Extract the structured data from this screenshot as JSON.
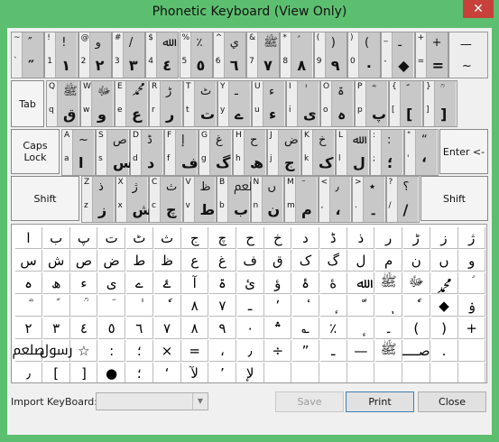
{
  "window": {
    "title": "Phonetic Keyboard (View Only)",
    "close_glyph": "✕"
  },
  "row1": {
    "keys": [
      {
        "top": "~",
        "bot": "`",
        "u1": "″",
        "u2": "″",
        "u3": "",
        "u4": ""
      },
      {
        "top": "!",
        "bot": "1",
        "u1": "!",
        "u2": "١",
        "u3": "",
        "u4": ""
      },
      {
        "top": "@",
        "bot": "2",
        "u1": "و",
        "u2": "٢",
        "u3": "",
        "u4": ""
      },
      {
        "top": "#",
        "bot": "3",
        "u1": "/",
        "u2": "٣",
        "u3": "",
        "u4": ""
      },
      {
        "top": "$",
        "bot": "4",
        "u1": "ﷲ",
        "u2": "٤",
        "u3": "",
        "u4": ""
      },
      {
        "top": "%",
        "bot": "5",
        "u1": "٪",
        "u2": "٥",
        "u3": "",
        "u4": ""
      },
      {
        "top": "^",
        "bot": "6",
        "u1": "ي",
        "u2": "٦",
        "u3": "",
        "u4": ""
      },
      {
        "top": "&",
        "bot": "7",
        "u1": "ﷺ",
        "u2": "٧",
        "u3": "",
        "u4": ""
      },
      {
        "top": "*",
        "bot": "8",
        "u1": "ؑ",
        "u2": "٨",
        "u3": "",
        "u4": ""
      },
      {
        "top": "(",
        "bot": "9",
        "u1": ")",
        "u2": "٩",
        "u3": "",
        "u4": ""
      },
      {
        "top": ")",
        "bot": "0",
        "u1": "(",
        "u2": "٠",
        "u3": "",
        "u4": ""
      },
      {
        "top": "_",
        "bot": "-",
        "u1": "ـ",
        "u2": "◆",
        "u3": "",
        "u4": ""
      },
      {
        "top": "+",
        "bot": "=",
        "u1": "+",
        "u2": "=",
        "u3": "",
        "u4": ""
      }
    ],
    "last": {
      "top": "",
      "u1": "—",
      "u2": "~"
    }
  },
  "row2_top": [
    "Q",
    "W",
    "E",
    "R",
    "T",
    "Y",
    "U",
    "I",
    "O",
    "P",
    "{",
    "}"
  ],
  "row2_bot": [
    "q",
    "w",
    "e",
    "r",
    "t",
    "y",
    "u",
    "i",
    "o",
    "p",
    "[",
    "]"
  ],
  "row2_u_top": [
    "ﷺ",
    "ﷻ",
    "ﷴ",
    "ڑ",
    "ٹ",
    "ـ",
    "ء",
    "ٰ",
    "ۃ",
    "ؓ",
    "ؐ",
    "ؒ"
  ],
  "row2_u_bot": [
    "ق",
    "و",
    "ع",
    "ر",
    "ت",
    "ے",
    "ء",
    "ی",
    "ہ",
    "پ",
    "[",
    "]"
  ],
  "row3_top": [
    "A",
    "S",
    "D",
    "F",
    "G",
    "H",
    "J",
    "K",
    "L",
    ":",
    "\""
  ],
  "row3_bot": [
    "a",
    "s",
    "d",
    "f",
    "g",
    "h",
    "j",
    "k",
    "l",
    ";",
    "'"
  ],
  "row3_u_top": [
    "~",
    "ص",
    "ڈ",
    "ﺇ",
    "غ",
    "ح",
    "ض",
    "خ",
    "ﷲ",
    ":",
    "“"
  ],
  "row3_u_bot": [
    "ا",
    "س",
    "د",
    "ف",
    "گ",
    "ھ",
    "ج",
    "ک",
    "ل",
    "؛",
    "‘"
  ],
  "row4_top": [
    "Z",
    "X",
    "C",
    "V",
    "B",
    "N",
    "M",
    "<",
    ">",
    "?"
  ],
  "row4_bot": [
    "z",
    "x",
    "c",
    "v",
    "b",
    "n",
    "m",
    ",",
    ".",
    "/"
  ],
  "row4_u_top": [
    "ذ",
    "ژ",
    "ث",
    "ظ",
    "ﷵ",
    "ں",
    "ؔ",
    "٫",
    "٭",
    "؟"
  ],
  "row4_u_bot": [
    "ز",
    "ش",
    "چ",
    "ط",
    "ب",
    "ن",
    "م",
    "،",
    "۔",
    "/"
  ],
  "special": {
    "tab": "Tab",
    "caps": "Caps\nLock",
    "enter": "Enter <-",
    "shift_left": "Shift",
    "shift_right": "Shift"
  },
  "grid_rows": [
    [
      "ا",
      "ب",
      "پ",
      "ت",
      "ٹ",
      "ث",
      "ج",
      "چ",
      "ح",
      "خ",
      "د",
      "ڈ",
      "ذ",
      "ر",
      "ڑ",
      "ز",
      "ژ"
    ],
    [
      "س",
      "ش",
      "ص",
      "ض",
      "ط",
      "ظ",
      "ع",
      "غ",
      "ف",
      "ق",
      "ک",
      "گ",
      "ل",
      "م",
      "ن",
      "ں",
      "و"
    ],
    [
      "ہ",
      "ھ",
      "ء",
      "ی",
      "ے",
      "ۓ",
      "آ",
      "ۃ",
      "ئ",
      "ؤ",
      "ۂ",
      "ۀ",
      "ﷲ",
      "ﷺ",
      "ﷻ",
      "ﷴ",
      "ؑ"
    ],
    [
      "ؓ",
      "ؐ",
      "ؒ",
      "ؔ",
      "ٰ",
      "ٗ",
      "۸",
      "۷",
      "ـ",
      "٬",
      "ٔ",
      "ٕ",
      "ّ",
      "ٖ",
      "ٗ",
      "◆",
      "ۏ"
    ],
    [
      "٢",
      "٣",
      "٤",
      "٥",
      "٦",
      "٧",
      "٨",
      "٩",
      "٠",
      "؞",
      "؎",
      "٪",
      "ٕ",
      "۔",
      "(",
      ")",
      "+"
    ],
    [
      "ﷵ",
      "ﷶ",
      "☆",
      ":",
      "؛",
      "×",
      "=",
      "،",
      "٫",
      "÷",
      "”",
      "ـ",
      "—",
      "ﷺ",
      "صــــ",
      ".",
      ""
    ],
    [
      "٫",
      "[",
      "]",
      "●",
      "؛",
      "‘",
      "لآ",
      "’",
      "لإ",
      "",
      "",
      "",
      "",
      "",
      "",
      "",
      ""
    ]
  ],
  "bottom": {
    "import_label": "Import KeyBoard:",
    "combo_value": "",
    "save_label": "Save",
    "print_label": "Print",
    "close_label": "Close"
  }
}
